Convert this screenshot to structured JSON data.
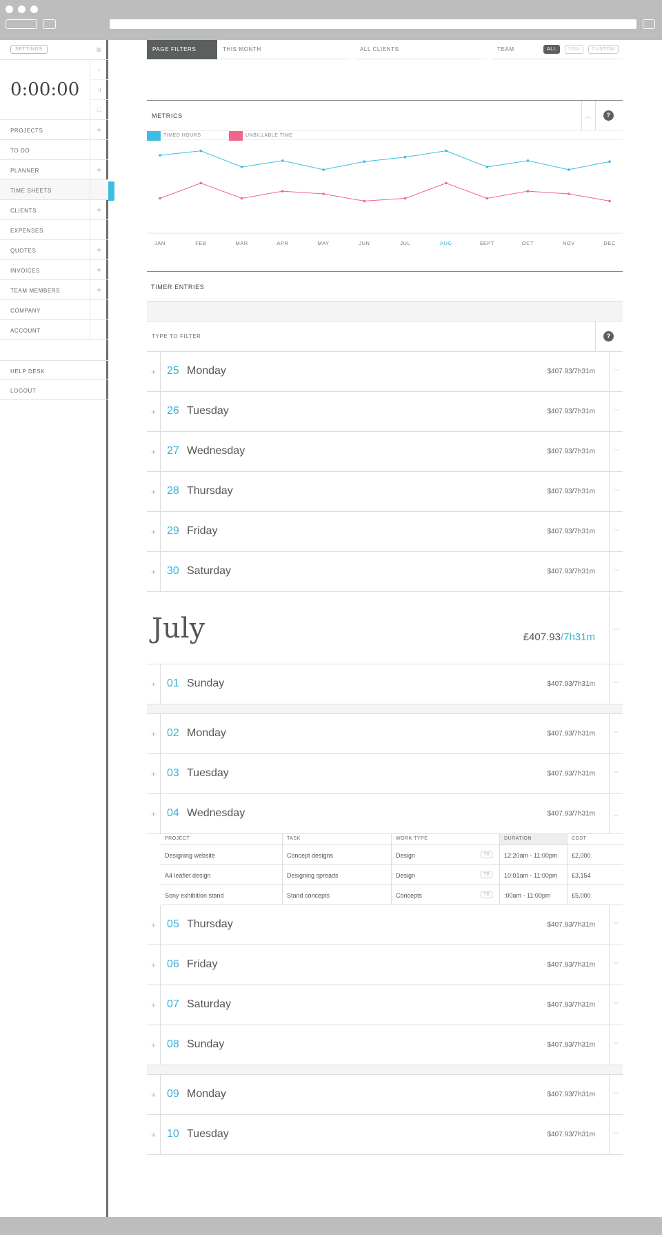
{
  "sidebar": {
    "settings_label": "SETTINGS",
    "timer": "0:00:00",
    "items": [
      {
        "label": "PROJECTS",
        "action": "+"
      },
      {
        "label": "TO DO",
        "action": ""
      },
      {
        "label": "PLANNER",
        "action": "+"
      },
      {
        "label": "TIME SHEETS",
        "action": ""
      },
      {
        "label": "CLIENTS",
        "action": "+"
      },
      {
        "label": "EXPENSES",
        "action": ""
      },
      {
        "label": "QUOTES",
        "action": "+"
      },
      {
        "label": "INVOICES",
        "action": "+"
      },
      {
        "label": "TEAM MEMBERS",
        "action": "+"
      },
      {
        "label": "COMPANY",
        "action": ""
      },
      {
        "label": "ACCOUNT",
        "action": ""
      }
    ],
    "footer_items": [
      "HELP DESK",
      "LOGOUT"
    ]
  },
  "filters": {
    "page_filters": "PAGE FILTERS",
    "period": "THIS MONTH",
    "clients": "ALL CLIENTS",
    "team": "TEAM",
    "team_options": [
      "ALL",
      "YOU",
      "CUSTOM"
    ]
  },
  "metrics": {
    "title": "METRICS",
    "help": "?",
    "legend": [
      {
        "label": "TIMED HOURS",
        "color": "#3dbde4"
      },
      {
        "label": "UNBILLABLE TIME",
        "color": "#f2658a"
      }
    ]
  },
  "chart_data": {
    "type": "line",
    "categories": [
      "JAN",
      "FEB",
      "MAR",
      "APR",
      "MAY",
      "JUN",
      "JUL",
      "AUG",
      "SEPT",
      "OCT",
      "NOV",
      "DEC"
    ],
    "highlight_category": "AUG",
    "ylim": [
      0,
      100
    ],
    "series": [
      {
        "name": "TIMED HOURS",
        "color": "#3dbde4",
        "values": [
          83,
          88,
          70,
          77,
          67,
          76,
          81,
          88,
          70,
          77,
          67,
          76
        ]
      },
      {
        "name": "UNBILLABLE TIME",
        "color": "#f2658a",
        "values": [
          35,
          52,
          35,
          43,
          40,
          32,
          35,
          52,
          35,
          43,
          40,
          32
        ]
      }
    ]
  },
  "timer_entries": {
    "title": "TIMER ENTRIES",
    "filter_placeholder": "TYPE TO FILTER",
    "help": "?"
  },
  "june_days": [
    {
      "num": "25",
      "name": "Monday",
      "amount": "$407.93/7h31m"
    },
    {
      "num": "26",
      "name": "Tuesday",
      "amount": "$407.93/7h31m"
    },
    {
      "num": "27",
      "name": "Wednesday",
      "amount": "$407.93/7h31m"
    },
    {
      "num": "28",
      "name": "Thursday",
      "amount": "$407.93/7h31m"
    },
    {
      "num": "29",
      "name": "Friday",
      "amount": "$407.93/7h31m"
    },
    {
      "num": "30",
      "name": "Saturday",
      "amount": "$407.93/7h31m"
    }
  ],
  "month": {
    "name": "July",
    "amount": "£407.93",
    "duration": "/7h31m"
  },
  "july_days": [
    {
      "num": "01",
      "name": "Sunday",
      "amount": "$407.93/7h31m"
    },
    {
      "num": "02",
      "name": "Monday",
      "amount": "$407.93/7h31m"
    },
    {
      "num": "03",
      "name": "Tuesday",
      "amount": "$407.93/7h31m"
    },
    {
      "num": "04",
      "name": "Wednesday",
      "amount": "$407.93/7h31m"
    },
    {
      "num": "05",
      "name": "Thursday",
      "amount": "$407.93/7h31m"
    },
    {
      "num": "06",
      "name": "Friday",
      "amount": "$407.93/7h31m"
    },
    {
      "num": "07",
      "name": "Saturday",
      "amount": "$407.93/7h31m"
    },
    {
      "num": "08",
      "name": "Sunday",
      "amount": "$407.93/7h31m"
    },
    {
      "num": "09",
      "name": "Monday",
      "amount": "$407.93/7h31m"
    },
    {
      "num": "10",
      "name": "Tuesday",
      "amount": "$407.93/7h31m"
    }
  ],
  "entry_table": {
    "columns": [
      "PROJECT",
      "TASK",
      "WORK TYPE",
      "DURATION",
      "COST"
    ],
    "badge": "TB",
    "rows": [
      [
        "Designing website",
        "Concept designs",
        "Design",
        "12:20am - 11:00pm",
        "£2,000"
      ],
      [
        "A4 leaflet design",
        "Designing spreads",
        "Design",
        "10:01am - 11:00pm",
        "£3,154"
      ],
      [
        "Sony exhibition stand",
        "Stand concepts",
        "Concepts",
        ":00am - 11:00pm",
        "£5,000"
      ]
    ]
  },
  "glyphs": {
    "plus": "+",
    "chev_down": "﹀",
    "chev_up": "︿",
    "menu": "≡",
    "play": "›",
    "pause": "॥",
    "stop": "□"
  }
}
